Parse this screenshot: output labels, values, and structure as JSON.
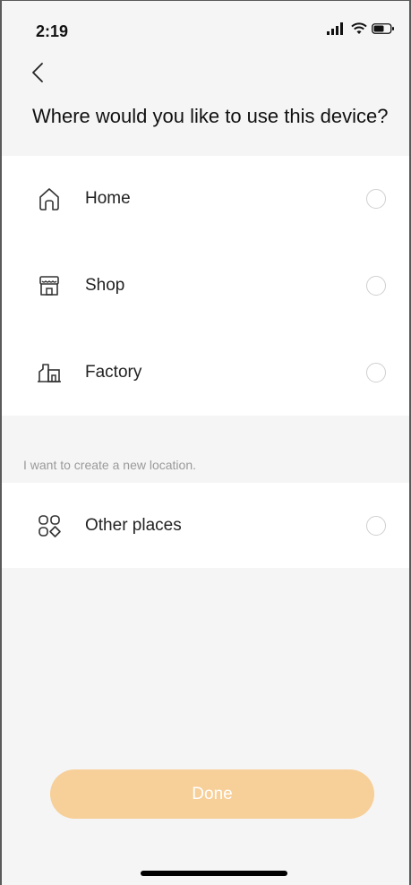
{
  "status_bar": {
    "time": "2:19"
  },
  "header": {
    "title": "Where would you like to use this device?"
  },
  "locations": [
    {
      "label": "Home",
      "icon": "house-icon",
      "selected": false
    },
    {
      "label": "Shop",
      "icon": "storefront-icon",
      "selected": false
    },
    {
      "label": "Factory",
      "icon": "factory-icon",
      "selected": false
    }
  ],
  "new_location": {
    "hint": "I want to create a new location.",
    "label": "Other places",
    "icon": "grid-shapes-icon",
    "selected": false
  },
  "footer": {
    "done_label": "Done"
  },
  "colors": {
    "accent_disabled": "#f7cf98",
    "background": "#f5f5f5",
    "card": "#ffffff"
  }
}
